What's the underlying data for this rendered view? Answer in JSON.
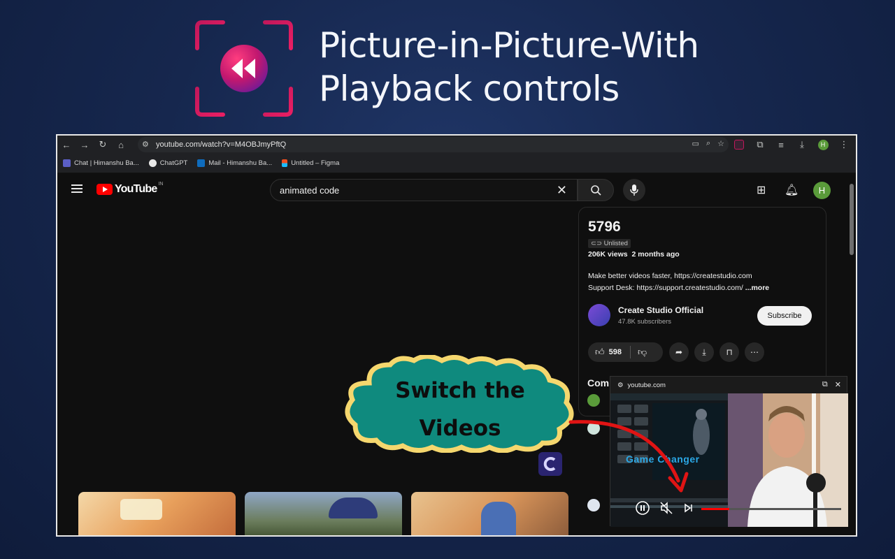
{
  "hero": {
    "title_line1": "Picture-in-Picture-With",
    "title_line2": "Playback controls",
    "logo_icon": "rewind-icon",
    "accent_color": "#d81b60"
  },
  "browser": {
    "url": "youtube.com/watch?v=M4OBJmyPftQ",
    "bookmarks": [
      {
        "label": "Chat | Himanshu Ba...",
        "icon": "teams-icon"
      },
      {
        "label": "ChatGPT",
        "icon": "chatgpt-icon"
      },
      {
        "label": "Mail - Himanshu Ba...",
        "icon": "outlook-icon"
      },
      {
        "label": "Untitled – Figma",
        "icon": "figma-icon"
      }
    ],
    "profile_initial": "H"
  },
  "youtube": {
    "logo_text": "YouTube",
    "region": "IN",
    "search_value": "animated code",
    "avatar_initial": "H",
    "video": {
      "title": "5796",
      "visibility": "Unlisted",
      "views": "206K views",
      "age": "2 months ago",
      "desc_line1": "Make better videos faster, https://createstudio.com",
      "desc_line2": "Support Desk: https://support.createstudio.com/",
      "more": "...more"
    },
    "channel": {
      "name": "Create Studio Official",
      "subscribers": "47.8K subscribers",
      "subscribe_label": "Subscribe"
    },
    "likes": "598",
    "comments_label": "Comm"
  },
  "pip": {
    "host": "youtube.com",
    "overlay_text": "Game Changer",
    "progress": 0.2
  },
  "callout": {
    "line1": "Switch the",
    "line2": "Videos",
    "fill_color": "#0f8a7e",
    "border_color": "#f5d76e"
  }
}
